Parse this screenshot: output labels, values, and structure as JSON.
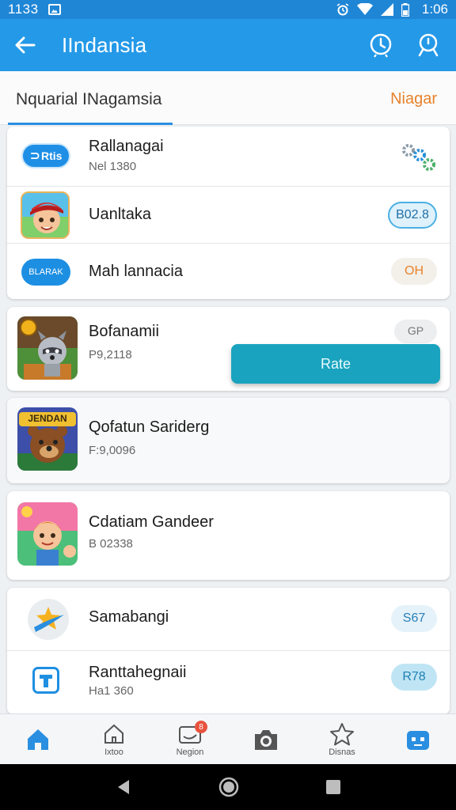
{
  "status_bar": {
    "time_left": "1133",
    "time_right": "1:06"
  },
  "app_bar": {
    "title": "IIndansia"
  },
  "tabs": {
    "left_label": "Nquarial INagamsia",
    "right_label": "Niagar"
  },
  "card1": {
    "items": [
      {
        "name": "Rallanagai",
        "sub": "Nel 1380",
        "icon_text": "Rtis",
        "icon": "rtis-logo-icon",
        "action_icon": "gears-icon"
      },
      {
        "name": "Uanltaka",
        "sub": "",
        "icon": "boy-avatar-icon",
        "pill": "B02.8"
      },
      {
        "name": "Mah lannacia",
        "sub": "",
        "icon_text": "BLARAK",
        "icon": "blarak-logo-icon",
        "pill": "OH"
      }
    ]
  },
  "card2": {
    "name": "Bofanamii",
    "sub": "P9,2118",
    "icon": "raccoon-game-icon",
    "pill": "GP"
  },
  "rate_button": {
    "label": "Rate"
  },
  "card3": {
    "name": "Qofatun Sariderg",
    "sub": "F:9,0096",
    "icon": "bear-game-icon",
    "icon_text": "JENDAN"
  },
  "card4": {
    "name": "Cdatiam Gandeer",
    "sub": "B 02338",
    "icon": "kid-game-icon"
  },
  "card5": {
    "items": [
      {
        "name": "Samabangi",
        "sub": "",
        "icon": "star-swoosh-icon",
        "pill": "S67"
      },
      {
        "name": "Ranttahegnaii",
        "sub": "Ha1 360",
        "icon": "t-logo-icon",
        "pill": "R78"
      }
    ]
  },
  "bottom_nav": {
    "items": [
      {
        "label": "",
        "icon": "home-icon"
      },
      {
        "label": "Ixtoo",
        "icon": "house-outline-icon"
      },
      {
        "label": "Negion",
        "icon": "inbox-icon",
        "badge": "8"
      },
      {
        "label": "",
        "icon": "camera-icon"
      },
      {
        "label": "Disnas",
        "icon": "star-icon"
      },
      {
        "label": "",
        "icon": "robot-icon"
      }
    ]
  },
  "colors": {
    "primary": "#2499e8",
    "accent": "#e7822a",
    "rate": "#1aa3bf"
  }
}
